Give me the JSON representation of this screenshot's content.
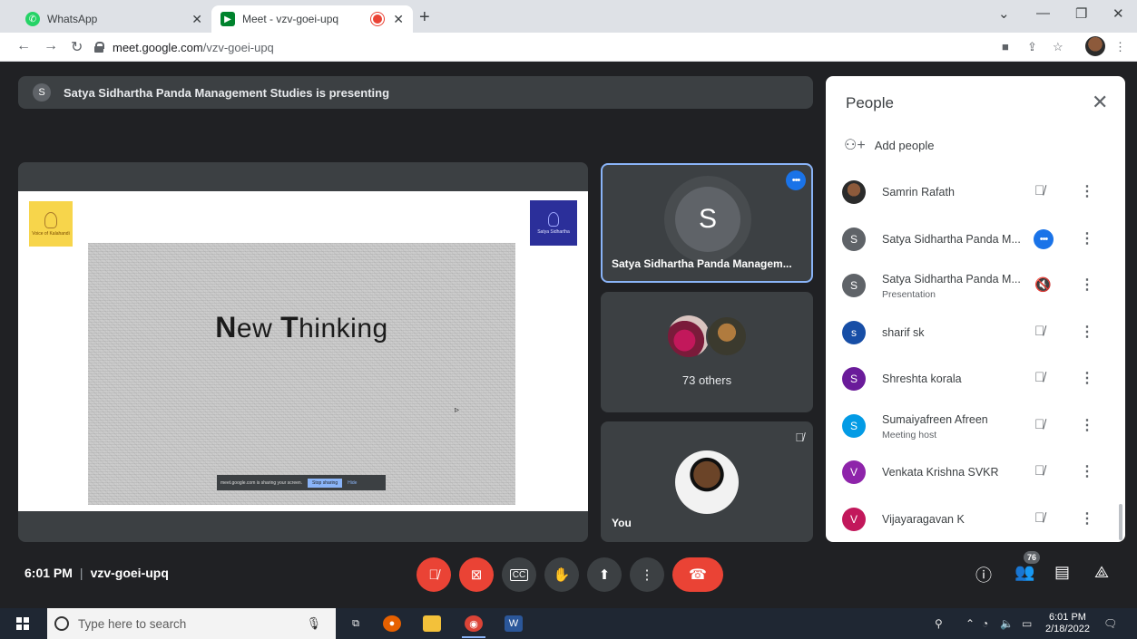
{
  "browser": {
    "tabs": [
      {
        "title": "WhatsApp",
        "favicon": "whatsapp-icon",
        "color": "#25d366"
      },
      {
        "title": "Meet - vzv-goei-upq",
        "favicon": "meet-icon",
        "color": "#00832d"
      }
    ],
    "url_domain": "meet.google.com",
    "url_path": "/vzv-goei-upq"
  },
  "presenting_banner": {
    "avatar_letter": "S",
    "text": "Satya Sidhartha Panda Management Studies is presenting"
  },
  "slide": {
    "logo_left_text": "Voice of Kalahandi",
    "logo_right_text": "Satya Sidhartha",
    "title_parts": [
      "N",
      "ew ",
      "T",
      "hinking"
    ],
    "share_notice": "meet.google.com is sharing your screen.",
    "stop_sharing": "Stop sharing",
    "hide": "Hide"
  },
  "tiles": {
    "presenter": {
      "avatar_letter": "S",
      "name": "Satya Sidhartha Panda Managem..."
    },
    "others": {
      "label": "73 others"
    },
    "you": {
      "label": "You"
    }
  },
  "people_panel": {
    "title": "People",
    "add_people": "Add people",
    "participants": [
      {
        "name": "Samrin Rafath",
        "subtitle": "",
        "avatar": "",
        "avatar_color": "#6d4c41",
        "status": "muted"
      },
      {
        "name": "Satya Sidhartha Panda M...",
        "subtitle": "",
        "avatar": "S",
        "avatar_color": "#5f6368",
        "status": "speaking"
      },
      {
        "name": "Satya Sidhartha Panda M...",
        "subtitle": "Presentation",
        "avatar": "S",
        "avatar_color": "#5f6368",
        "status": "presenting"
      },
      {
        "name": "sharif sk",
        "subtitle": "",
        "avatar": "s",
        "avatar_color": "#174ea6",
        "status": "muted"
      },
      {
        "name": "Shreshta korala",
        "subtitle": "",
        "avatar": "S",
        "avatar_color": "#6a1b9a",
        "status": "muted"
      },
      {
        "name": "Sumaiyafreen Afreen",
        "subtitle": "Meeting host",
        "avatar": "S",
        "avatar_color": "#039be5",
        "status": "muted"
      },
      {
        "name": "Venkata Krishna SVKR",
        "subtitle": "",
        "avatar": "V",
        "avatar_color": "#8e24aa",
        "status": "muted"
      },
      {
        "name": "Vijayaragavan K",
        "subtitle": "",
        "avatar": "V",
        "avatar_color": "#c2185b",
        "status": "muted"
      }
    ]
  },
  "controls": {
    "time": "6:01 PM",
    "meeting_code": "vzv-goei-upq",
    "participant_count": "76"
  },
  "taskbar": {
    "search_placeholder": "Type here to search",
    "time": "6:01 PM",
    "date": "2/18/2022"
  },
  "colors": {
    "meet_bg": "#202124",
    "tile_bg": "#3c4043",
    "accent": "#1a73e8",
    "danger": "#ea4335"
  }
}
